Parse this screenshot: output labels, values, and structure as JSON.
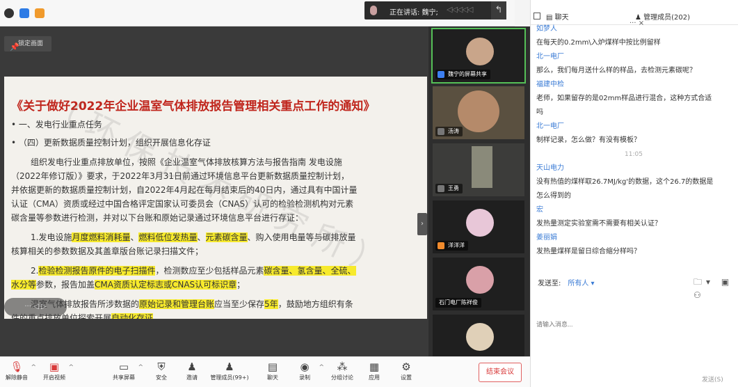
{
  "app": {
    "speaking_label": "正在讲话: 魏宁;",
    "speaking_wave": "◁◁◁◁◁",
    "pin_icon": "↰",
    "lock_screen": "锁定画面",
    "slide_control": "··· ◁ ▷"
  },
  "slide": {
    "title": "《关于做好2022年企业温室气体排放报告管理相关重点工作的通知》",
    "bullet1": "• 一、发电行业重点任务",
    "bullet2": "• （四）更新数据质量控制计划，组织开展信息化存证",
    "para1_l1": "组织发电行业重点排放单位，按照《企业温室气体排放核算方法与报告指南 发电设施",
    "para1_l2": "（2022年修订版）》要求，于2022年3月31日前通过环境信息平台更新数据质量控制计划，",
    "para1_l3": "并依据更新的数据质量控制计划，自2022年4月起在每月结束后的40日内，通过具有中国计量",
    "para1_l4": "认证（CMA）资质或经过中国合格评定国家认可委员会（CNAS）认可的检验检测机构对元素",
    "para1_l5": "碳含量等参数进行检测，并对以下台账和原始记录通过环境信息平台进行存证：",
    "item1_a": "1.发电设施",
    "item1_h1": "月度燃料消耗量",
    "item1_b": "、",
    "item1_h2": "燃料低位发热量",
    "item1_c": "、",
    "item1_h3": "元素碳含量",
    "item1_d": "、购入使用电量等与碳排放量",
    "item1_l2": "核算相关的参数数据及其盖章版台账记录扫描文件；",
    "item2_a": "2.",
    "item2_h1": "检验检测报告原件的电子扫描件",
    "item2_b": "，检测数应至少包括样品元素",
    "item2_h2": "碳含量、氢含量、全硫、",
    "item2_h3": "水分等",
    "item2_c": "参数，报告加盖",
    "item2_h4": "CMA资质认定标志或CNAS认可标识章",
    "item2_d": "；",
    "item3_a": "温室气体排放报告所涉数据的",
    "item3_h1": "原始记录和管理台账",
    "item3_b": "应当至少保存",
    "item3_h2": "5年",
    "item3_c": "，鼓励地方组织有条",
    "item3_l2a": "件的重点排放单位探索开展",
    "item3_l2h": "自动化存证",
    "item3_l2b": "。",
    "watermark": "（ 环 保 技 术 研 究 所 ）"
  },
  "gallery": [
    {
      "name": "魏宁的屏幕共享",
      "face": "#c9a58a"
    },
    {
      "name": "汤涛",
      "face": "#b58a6a"
    },
    {
      "name": "王勇",
      "face": "#8a8a7a"
    },
    {
      "name": "洋洋洋",
      "face": "#e8c7d8"
    },
    {
      "name": "石门电厂陈祥俊",
      "face": "#d9a0a8"
    },
    {
      "name": "",
      "face": "#e0d0b8"
    }
  ],
  "toolbar": {
    "mute": "解除静音",
    "video": "开启视频",
    "share": "共享屏幕",
    "security": "安全",
    "invite": "邀请",
    "members": "管理成员(99+)",
    "chat": "聊天",
    "record": "录制",
    "breakout": "分组讨论",
    "apps": "应用",
    "settings": "设置",
    "end": "结束会议"
  },
  "panel": {
    "tab_chat": "聊天",
    "tab_members": "管理成员(202)",
    "close_icon": "··· ×",
    "messages": [
      {
        "type": "sender",
        "text": "如梦人"
      },
      {
        "type": "text",
        "text": "在每天的0.2mm\\入炉煤样中按比例留样"
      },
      {
        "type": "sender",
        "text": "北一电厂"
      },
      {
        "type": "text",
        "text": "那么，我们每月送什么样的样品，去检测元素碳呢？"
      },
      {
        "type": "sender",
        "text": "福建中检"
      },
      {
        "type": "text",
        "text": "老师，如果留存的是02mm样品进行混合，这种方式合适"
      },
      {
        "type": "text",
        "text": "吗"
      },
      {
        "type": "sender",
        "text": "北一电厂"
      },
      {
        "type": "text",
        "text": "制样记录，怎么做？有没有模板？"
      },
      {
        "type": "time",
        "text": "11:05"
      },
      {
        "type": "sender",
        "text": "天山电力"
      },
      {
        "type": "text",
        "text": "没有热值的煤样取26.7MJ/kg'的数据，这个26.7的数据是"
      },
      {
        "type": "text",
        "text": "怎么得到的"
      },
      {
        "type": "sender",
        "text": "宏"
      },
      {
        "type": "text",
        "text": "发热量测定实验室需不需要有相关认证？"
      },
      {
        "type": "sender",
        "text": "姜丽娟"
      },
      {
        "type": "text",
        "text": "发热量煤样是留日综合缩分样吗？"
      }
    ],
    "send_to_label": "发送至:",
    "send_to_who": "所有人 ▾",
    "tool_icons": "🗀▾ ▣ ⚇",
    "input_placeholder": "请输入消息...",
    "send_button": "发送(S)"
  }
}
